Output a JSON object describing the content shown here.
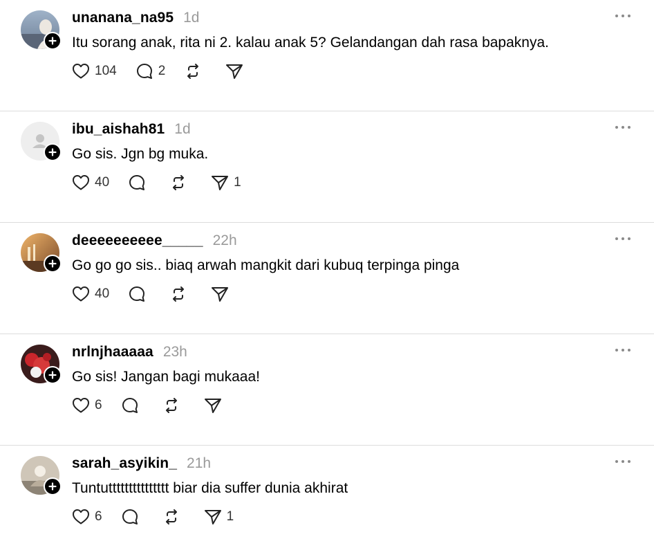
{
  "posts": [
    {
      "username": "unanana_na95",
      "time": "1d",
      "text": "Itu sorang anak, rita ni 2. kalau anak 5? Gelandangan dah rasa bapaknya.",
      "likes": "104",
      "replies": "2",
      "reposts": "",
      "shares": ""
    },
    {
      "username": "ibu_aishah81",
      "time": "1d",
      "text": "Go sis. Jgn bg muka.",
      "likes": "40",
      "replies": "",
      "reposts": "",
      "shares": "1"
    },
    {
      "username": "deeeeeeeeee_____",
      "time": "22h",
      "text": "Go go go sis.. biaq arwah mangkit dari kubuq terpinga pinga",
      "likes": "40",
      "replies": "",
      "reposts": "",
      "shares": ""
    },
    {
      "username": "nrlnjhaaaaa",
      "time": "23h",
      "text": "Go sis! Jangan bagi mukaaa!",
      "likes": "6",
      "replies": "",
      "reposts": "",
      "shares": ""
    },
    {
      "username": "sarah_asyikin_",
      "time": "21h",
      "text": "Tuntuttttttttttttttt biar dia suffer dunia akhirat",
      "likes": "6",
      "replies": "",
      "reposts": "",
      "shares": "1"
    }
  ],
  "icons": {
    "like": "heart-icon",
    "reply": "comment-icon",
    "repost": "repost-icon",
    "share": "send-icon",
    "more": "more-icon",
    "follow": "plus-icon"
  },
  "colors": {
    "text": "#000000",
    "muted": "#9a9a9a",
    "divider": "#dcdcdc"
  }
}
